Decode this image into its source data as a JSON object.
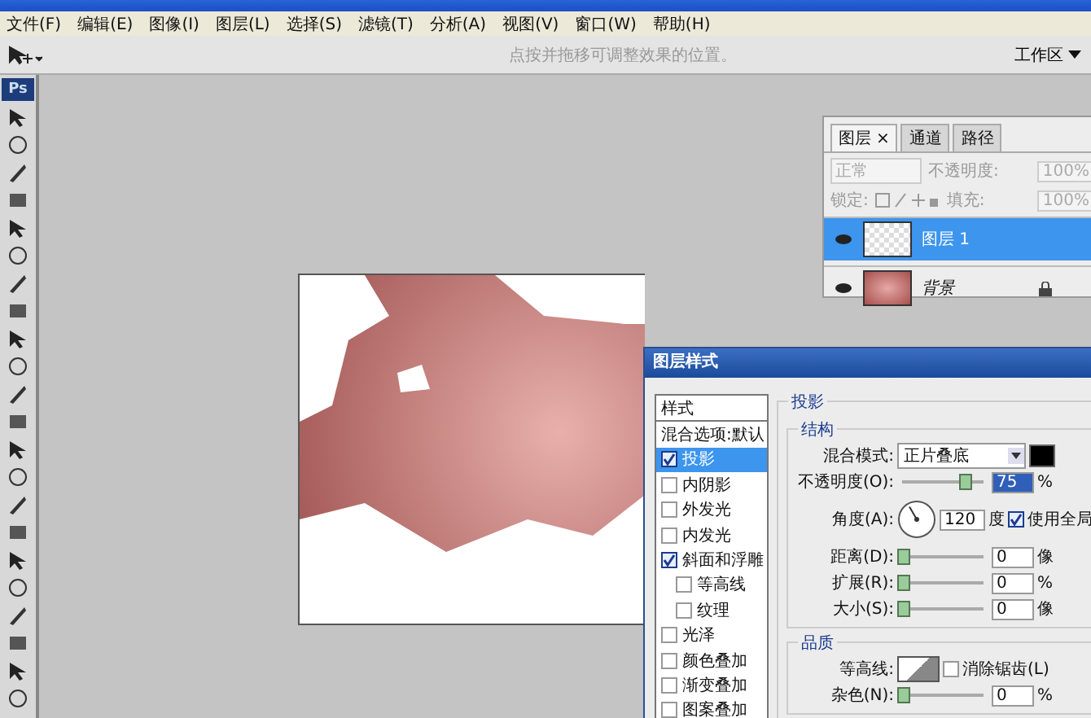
{
  "menu": [
    "文件(F)",
    "编辑(E)",
    "图像(I)",
    "图层(L)",
    "选择(S)",
    "滤镜(T)",
    "分析(A)",
    "视图(V)",
    "窗口(W)",
    "帮助(H)"
  ],
  "options_bar": {
    "hint": "点按并拖移可调整效果的位置。",
    "workspace": "工作区"
  },
  "toolbox": {
    "logo": "Ps"
  },
  "layers_panel": {
    "tabs": [
      {
        "label": "图层",
        "selected": true,
        "close": "×"
      },
      {
        "label": "通道",
        "selected": false
      },
      {
        "label": "路径",
        "selected": false
      }
    ],
    "blend_mode": "正常",
    "opacity_label": "不透明度:",
    "opacity": "100%",
    "lock_label": "锁定:",
    "fill_label": "填充:",
    "fill": "100%",
    "layers": [
      {
        "name": "图层 1",
        "selected": true,
        "kind": "transparent",
        "locked": false
      },
      {
        "name": "背景",
        "selected": false,
        "kind": "image",
        "locked": true
      }
    ]
  },
  "layer_style_dialog": {
    "title": "图层样式",
    "styles": [
      {
        "label": "样式",
        "kind": "header",
        "selected": false
      },
      {
        "label": "混合选项:默认",
        "kind": "plain",
        "selected": false
      },
      {
        "label": "投影",
        "kind": "check",
        "checked": true,
        "selected": true
      },
      {
        "label": "内阴影",
        "kind": "check",
        "checked": false,
        "selected": false
      },
      {
        "label": "外发光",
        "kind": "check",
        "checked": false,
        "selected": false
      },
      {
        "label": "内发光",
        "kind": "check",
        "checked": false,
        "selected": false
      },
      {
        "label": "斜面和浮雕",
        "kind": "check",
        "checked": true,
        "selected": false,
        "children": [
          {
            "label": "等高线",
            "kind": "check",
            "checked": false,
            "selected": false
          },
          {
            "label": "纹理",
            "kind": "check",
            "checked": false,
            "selected": false
          }
        ]
      },
      {
        "label": "光泽",
        "kind": "check",
        "checked": false,
        "selected": false
      },
      {
        "label": "颜色叠加",
        "kind": "check",
        "checked": false,
        "selected": false
      },
      {
        "label": "渐变叠加",
        "kind": "check",
        "checked": false,
        "selected": false
      },
      {
        "label": "图案叠加",
        "kind": "check",
        "checked": false,
        "selected": false
      }
    ],
    "section": "投影",
    "structure": "结构",
    "blend_label": "混合模式:",
    "blend_mode": "正片叠底",
    "opacity": {
      "label": "不透明度(O):",
      "level": 0.75,
      "value": "75",
      "unit": "%"
    },
    "angle_label": "角度(A):",
    "angle_value": "120",
    "angle_unit": "度",
    "global_light": {
      "label": "使用全局",
      "checked": true
    },
    "sliders": [
      {
        "label": "距离(D):",
        "level": 0,
        "value": "0",
        "unit": "像"
      },
      {
        "label": "扩展(R):",
        "level": 0,
        "value": "0",
        "unit": "%"
      },
      {
        "label": "大小(S):",
        "level": 0,
        "value": "0",
        "unit": "像"
      }
    ],
    "quality": "品质",
    "contour_label": "等高线:",
    "antialias": {
      "label": "消除锯齿(L)",
      "checked": false
    },
    "noise": {
      "label": "杂色(N):",
      "level": 0,
      "value": "0",
      "unit": "%"
    }
  }
}
